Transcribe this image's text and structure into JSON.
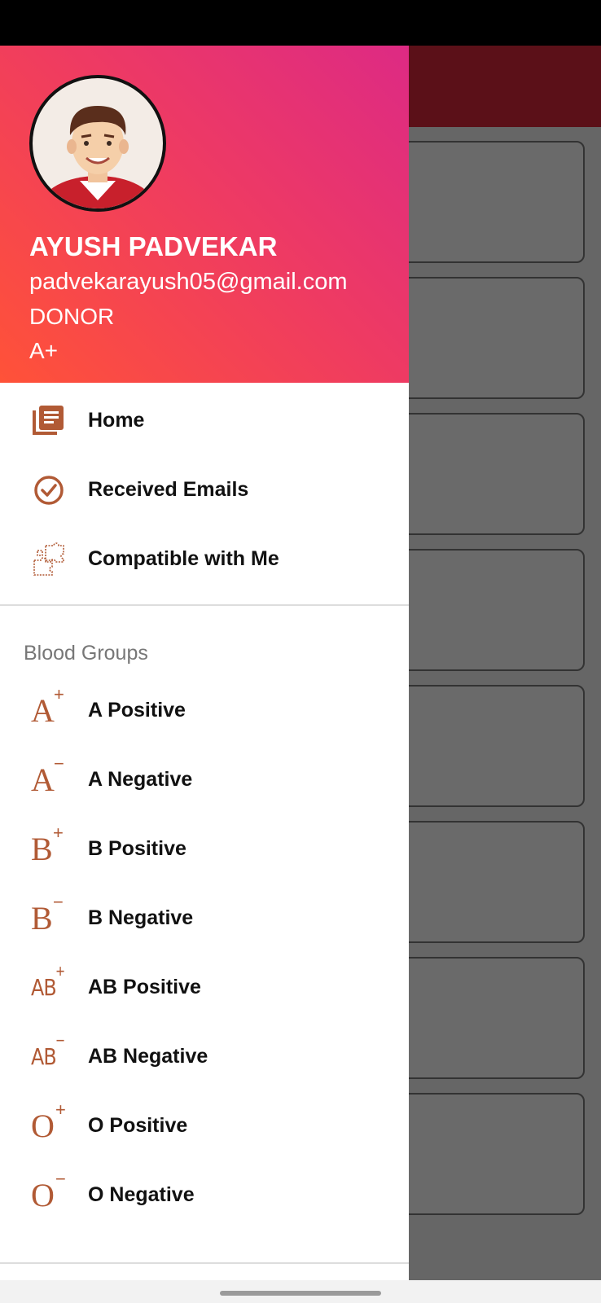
{
  "profile": {
    "name": "AYUSH PADVEKAR",
    "email": "padvekarayush05@gmail.com",
    "role": "DONOR",
    "blood_group": "A+"
  },
  "menu": {
    "items": [
      {
        "label": "Home",
        "icon": "book-icon"
      },
      {
        "label": "Received Emails",
        "icon": "check-circle-icon"
      },
      {
        "label": "Compatible with Me",
        "icon": "puzzle-icon"
      }
    ]
  },
  "blood_groups": {
    "title": "Blood Groups",
    "items": [
      {
        "label": "A Positive",
        "letter": "A",
        "sign": "+"
      },
      {
        "label": "A Negative",
        "letter": "A",
        "sign": "−"
      },
      {
        "label": "B Positive",
        "letter": "B",
        "sign": "+"
      },
      {
        "label": "B Negative",
        "letter": "B",
        "sign": "−"
      },
      {
        "label": "AB Positive",
        "letter": "AB",
        "sign": "+"
      },
      {
        "label": "AB Negative",
        "letter": "AB",
        "sign": "−"
      },
      {
        "label": "O Positive",
        "letter": "O",
        "sign": "+"
      },
      {
        "label": "O Negative",
        "letter": "O",
        "sign": "−"
      }
    ]
  },
  "colors": {
    "accent": "#b15a35",
    "header_start": "#ff5238",
    "header_end": "#dd2a84",
    "appbar": "#5b1018"
  }
}
